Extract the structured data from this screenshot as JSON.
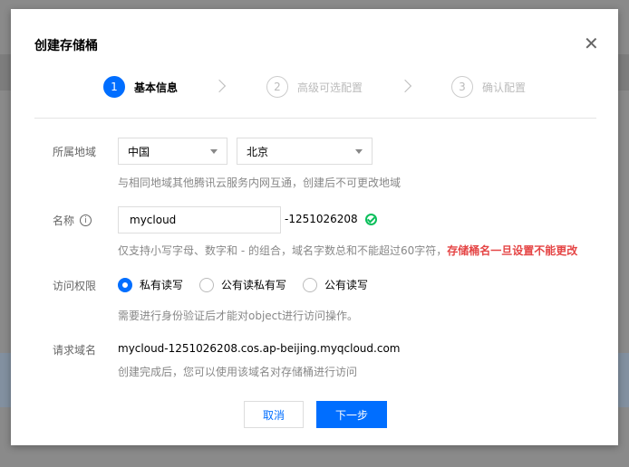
{
  "dialog": {
    "title": "创建存储桶",
    "close_icon": "close-icon"
  },
  "steps": [
    {
      "num": "1",
      "label": "基本信息",
      "active": true
    },
    {
      "num": "2",
      "label": "高级可选配置"
    },
    {
      "num": "3",
      "label": "确认配置"
    }
  ],
  "region": {
    "label": "所属地域",
    "country": "中国",
    "city": "北京",
    "hint": "与相同地域其他腾讯云服务内网互通，创建后不可更改地域"
  },
  "name": {
    "label": "名称",
    "value": "mycloud",
    "suffix": "-1251026208",
    "hint": "仅支持小写字母、数字和 - 的组合，域名字数总和不能超过60字符，",
    "warning": "存储桶名一旦设置不能更改"
  },
  "access": {
    "label": "访问权限",
    "options": [
      "私有读写",
      "公有读私有写",
      "公有读写"
    ],
    "selected": 0,
    "hint": "需要进行身份验证后才能对object进行访问操作。"
  },
  "domain": {
    "label": "请求域名",
    "value": "mycloud-1251026208.cos.ap-beijing.myqcloud.com",
    "hint": "创建完成后，您可以使用该域名对存储桶进行访问"
  },
  "buttons": {
    "cancel": "取消",
    "next": "下一步"
  },
  "colors": {
    "primary": "#006eff",
    "success": "#0abf5b",
    "danger": "#e54545"
  }
}
